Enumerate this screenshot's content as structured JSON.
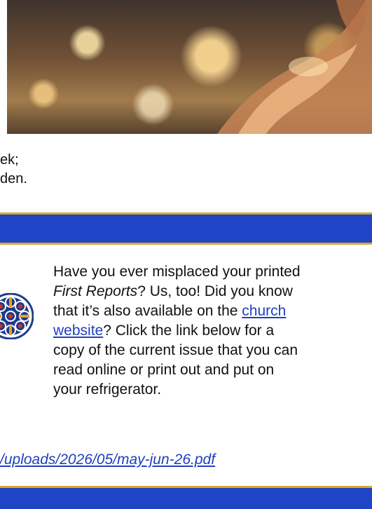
{
  "hero_image": {
    "alt": "hands raised toward sunlight"
  },
  "previous_section": {
    "line1": "ek;",
    "line2": "den."
  },
  "first_reports": {
    "logo_icon": "rose-window-icon",
    "line1": "Have you ever misplaced your printed",
    "line2_title": "First Reports",
    "line2_rest": "?  Us, too!  Did you know",
    "line3_pre": "that it’s also available on the ",
    "line3_link": "church",
    "line4_link": "website",
    "line4_rest": "?  Click the link below for a",
    "line5": "copy of the current issue that you can",
    "line6": "read online or print out and put on",
    "line7": "your refrigerator.",
    "pdf_link": "/uploads/2026/05/may-jun-26.pdf"
  },
  "colors": {
    "band": "#1f45c6",
    "accent": "#d9a82a",
    "link": "#1f3fbf"
  }
}
